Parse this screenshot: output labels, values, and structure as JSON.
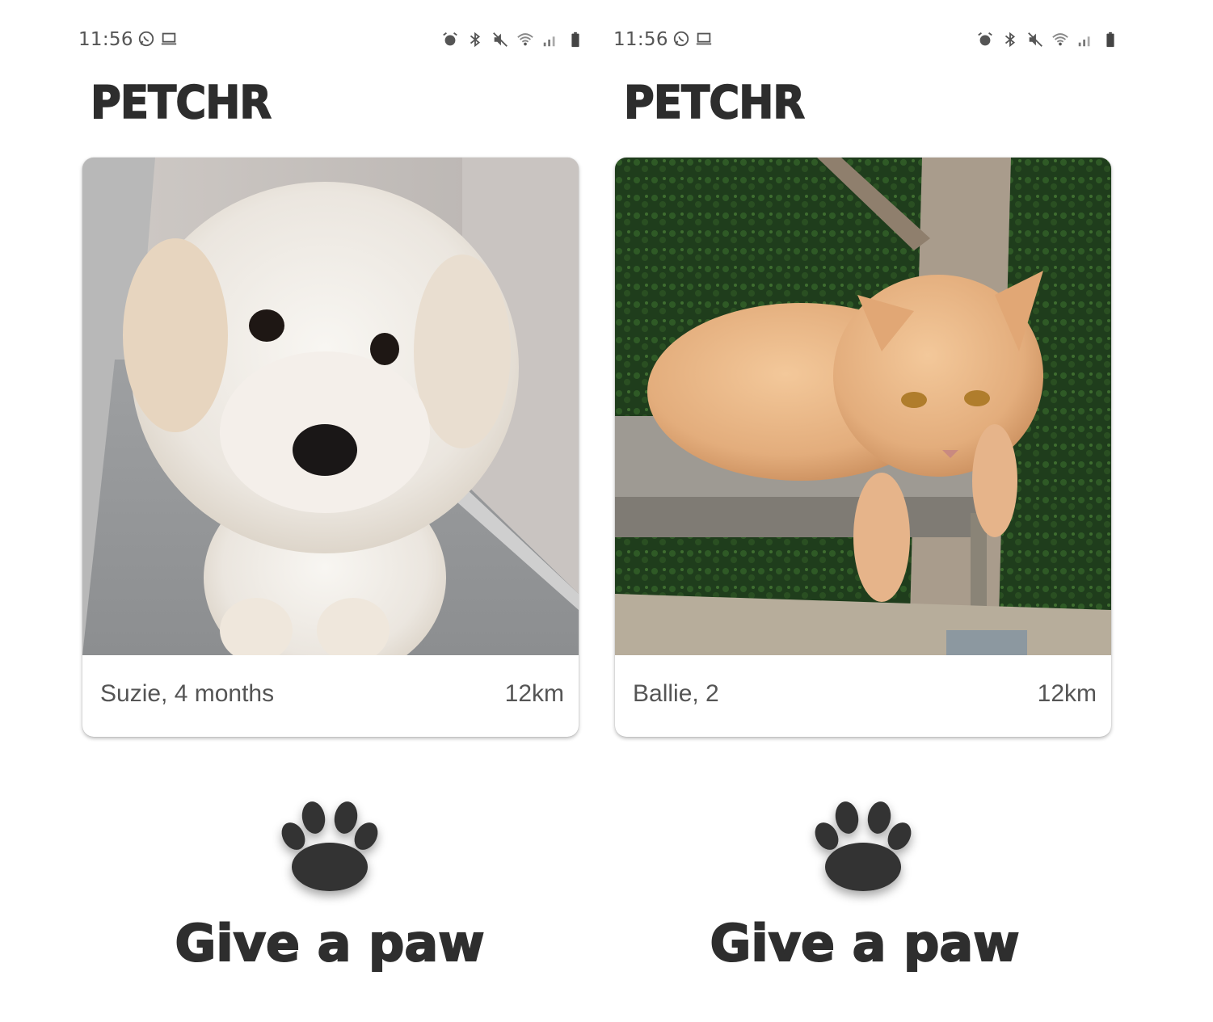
{
  "screens": [
    {
      "status_time": "11:56",
      "status_left_icons": [
        "whatsapp-icon",
        "laptop-icon"
      ],
      "status_right_icons": [
        "alarm-icon",
        "bluetooth-icon",
        "mute-icon",
        "wifi-icon",
        "signal-icon",
        "battery-icon"
      ],
      "brand": "PETCHR",
      "pet": {
        "species": "dog",
        "info": "Suzie, 4 months",
        "distance": "12km"
      },
      "cta_icon": "paw-icon",
      "cta_label": "Give a paw"
    },
    {
      "status_time": "11:56",
      "status_left_icons": [
        "whatsapp-icon",
        "laptop-icon"
      ],
      "status_right_icons": [
        "alarm-icon",
        "bluetooth-icon",
        "mute-icon",
        "wifi-icon",
        "signal-icon",
        "battery-icon"
      ],
      "brand": "PETCHR",
      "pet": {
        "species": "cat",
        "info": "Ballie, 2",
        "distance": "12km"
      },
      "cta_icon": "paw-icon",
      "cta_label": "Give a paw"
    }
  ],
  "colors": {
    "text_dark": "#2d2d2d",
    "text_muted": "#555555",
    "background": "#ffffff"
  }
}
